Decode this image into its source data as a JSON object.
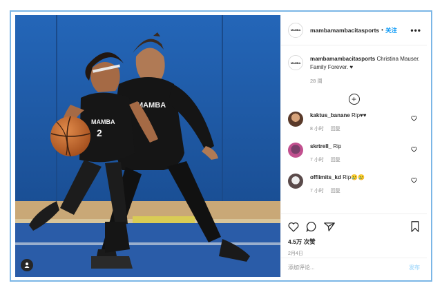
{
  "post": {
    "header": {
      "username": "mambamambacitasports",
      "dot": "•",
      "follow_label": "关注",
      "more": "•••",
      "logo_text": "MAMBA"
    },
    "caption": {
      "username": "mambamambacitasports",
      "text": "Christina Mauser. Family Forever. ♥",
      "time": "28 周"
    },
    "comments": [
      {
        "username": "kaktus_banane",
        "text": "Rip♥♥",
        "time": "8 小时",
        "reply": "回复"
      },
      {
        "username": "skrtrell_",
        "text": "Rip",
        "time": "7 小时",
        "reply": "回复"
      },
      {
        "username": "offlimits_kd",
        "text": "Rip😢😢",
        "time": "7 小时",
        "reply": "回复"
      }
    ],
    "likes": "4.5万 次赞",
    "date": "2月4日",
    "add_comment_placeholder": "添加评论...",
    "post_label": "发布"
  },
  "photo": {
    "jersey_front": "MAMBA",
    "jersey_back": "MAMBA",
    "jersey_number": "2"
  },
  "icons": [
    "user-tag-icon",
    "heart-icon",
    "comment-icon",
    "share-icon",
    "bookmark-icon",
    "plus-circle-icon",
    "more-icon"
  ],
  "colors": {
    "follow": "#0095f6",
    "muted": "#8e8e8e",
    "frame_border": "#7bb6e6",
    "post_disabled": "#b2dffc"
  }
}
